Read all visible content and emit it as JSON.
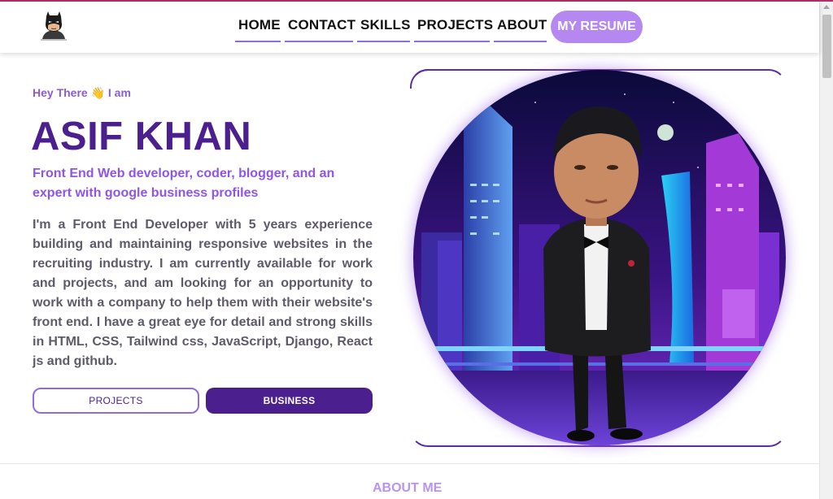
{
  "nav": {
    "items": [
      {
        "label": "HOME"
      },
      {
        "label": "CONTACT"
      },
      {
        "label": "SKILLS"
      },
      {
        "label": "PROJECTS"
      },
      {
        "label": "ABOUT"
      }
    ],
    "resume_label": "MY RESUME"
  },
  "hero": {
    "greeting": "Hey There 👋 I am",
    "name": "ASIF KHAN",
    "tagline": "Front End Web developer, coder, blogger, and an expert with google business profiles",
    "bio": "I'm a Front End Developer with 5 years experience building and maintaining responsive websites in the recruiting industry. I am currently available for work and projects, and am looking for an opportunity to work with a company to help them with their website's front end. I have a great eye for detail and strong skills in HTML, CSS, Tailwind css, JavaScript, Django, React js and github.",
    "buttons": {
      "projects": "PROJECTS",
      "business": "BUSINESS"
    }
  },
  "sections": {
    "about_heading": "ABOUT ME"
  },
  "colors": {
    "primary": "#4b1f8e",
    "accent": "#8f6be0",
    "resume_bg": "#b488f0",
    "top_line": "#b0306a"
  }
}
